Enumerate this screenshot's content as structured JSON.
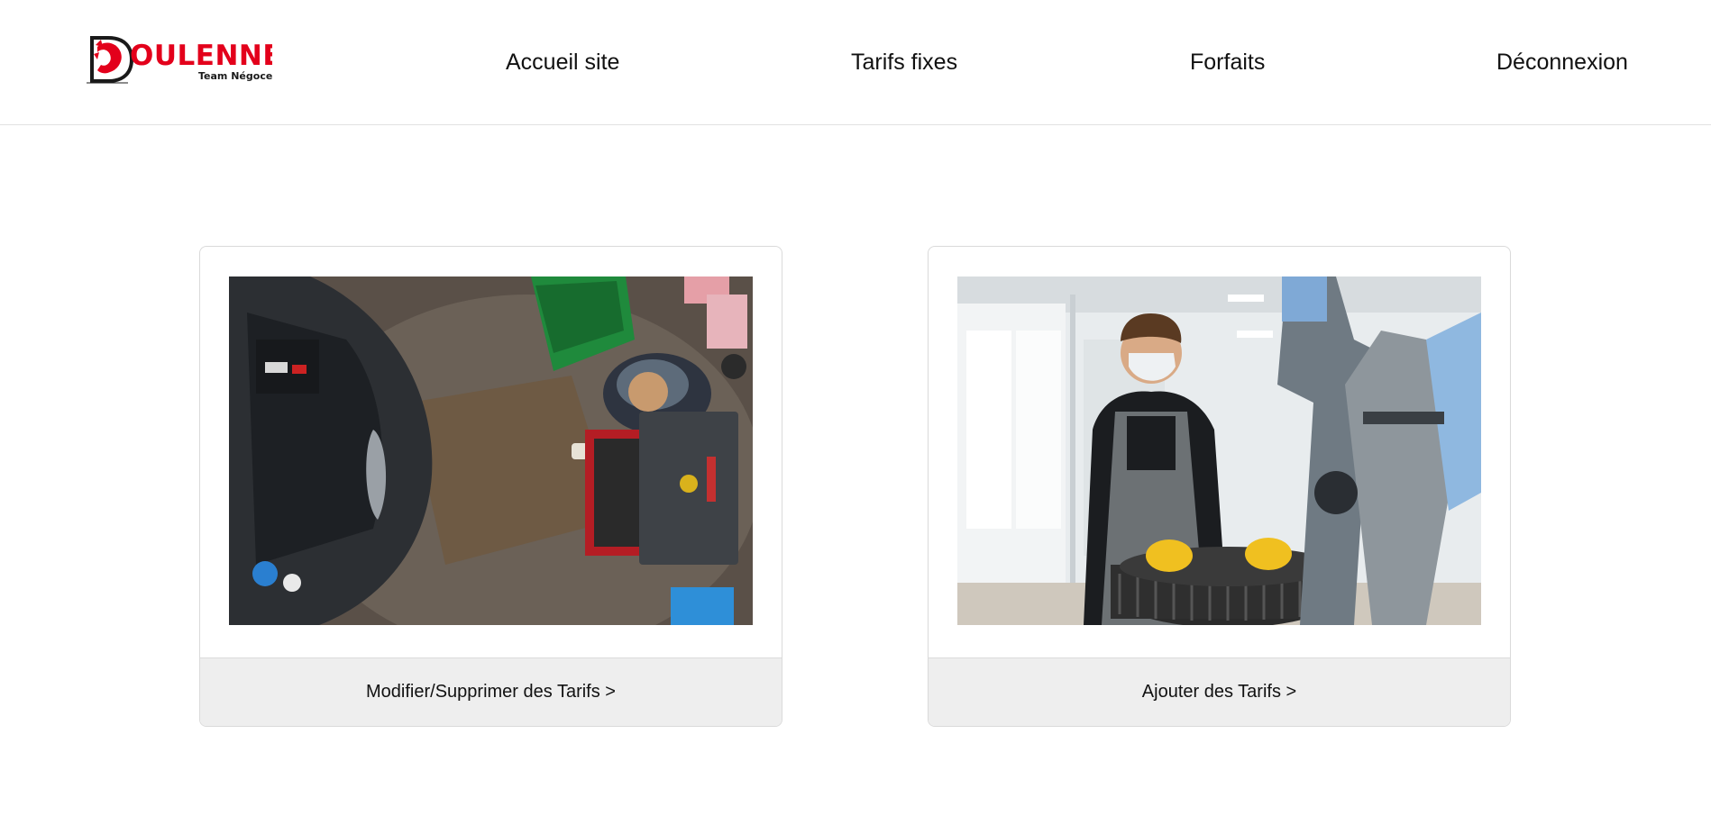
{
  "header": {
    "logo": {
      "brand_text": "OULENNE",
      "tagline": "Team Négoce",
      "initial": "D",
      "brand_color": "#e3001b"
    },
    "nav": [
      {
        "label": "Accueil site"
      },
      {
        "label": "Tarifs fixes"
      },
      {
        "label": "Forfaits"
      },
      {
        "label": "Déconnexion"
      }
    ]
  },
  "cards": [
    {
      "image": "mechanic-engine-overhead-photo",
      "link_label": "Modifier/Supprimer des Tarifs >"
    },
    {
      "image": "mechanic-tire-change-photo",
      "link_label": "Ajouter des Tarifs >"
    }
  ],
  "colors": {
    "header_border": "#e2e2e2",
    "card_footer_bg": "#eeeeee",
    "text": "#111111"
  }
}
